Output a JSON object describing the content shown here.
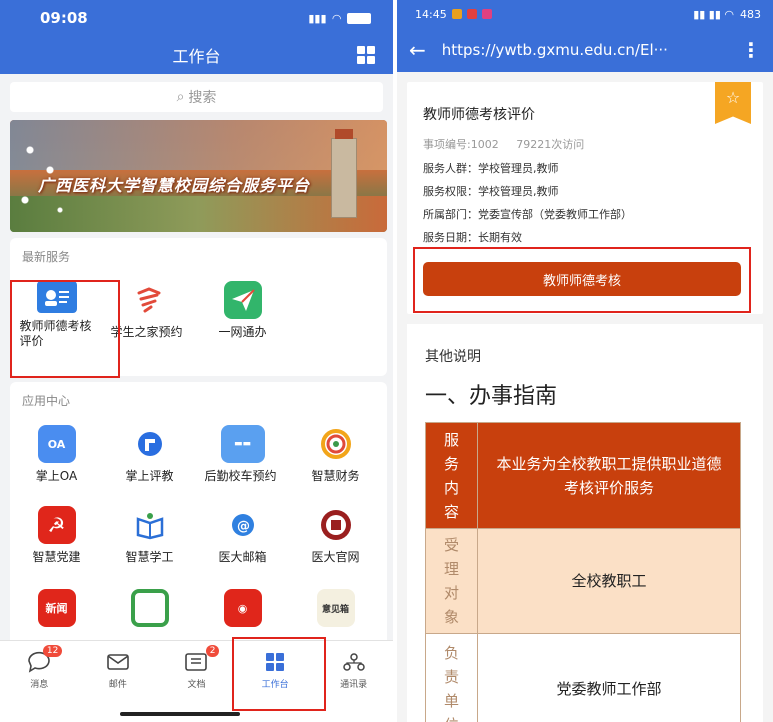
{
  "left": {
    "status_time": "09:08",
    "header_title": "工作台",
    "search_placeholder": "搜索",
    "banner_text": "广西医科大学智慧校园综合服务平台",
    "latest_section": {
      "title": "最新服务",
      "items": [
        {
          "label": "教师师德考核评价",
          "icon": "teacher-card-icon"
        },
        {
          "label": "学生之家预约",
          "icon": "student-home-icon"
        },
        {
          "label": "一网通办",
          "icon": "paper-plane-icon"
        }
      ]
    },
    "app_center": {
      "title": "应用中心",
      "items": [
        {
          "label": "掌上OA",
          "icon": "oa-icon"
        },
        {
          "label": "掌上评教",
          "icon": "teaching-eval-icon"
        },
        {
          "label": "后勤校车预约",
          "icon": "school-bus-icon"
        },
        {
          "label": "智慧财务",
          "icon": "finance-icon"
        },
        {
          "label": "智慧党建",
          "icon": "party-building-icon"
        },
        {
          "label": "智慧学工",
          "icon": "student-affairs-icon"
        },
        {
          "label": "医大邮箱",
          "icon": "mail-icon"
        },
        {
          "label": "医大官网",
          "icon": "official-site-icon"
        }
      ]
    },
    "bottom_icons_partial": {
      "news_label": "新闻",
      "opinion_label": "意见箱"
    },
    "tabs": [
      {
        "label": "消息",
        "icon": "message-icon",
        "badge": "12"
      },
      {
        "label": "邮件",
        "icon": "mail-icon",
        "badge": ""
      },
      {
        "label": "文档",
        "icon": "document-icon",
        "badge": "2"
      },
      {
        "label": "工作台",
        "icon": "workbench-icon",
        "badge": "",
        "active": true
      },
      {
        "label": "通讯录",
        "icon": "contacts-icon",
        "badge": ""
      }
    ],
    "colors": {
      "primary": "#3a6fd8",
      "highlight": "#e0241c"
    }
  },
  "right": {
    "status_time": "14:45",
    "status_right": "483",
    "url": "https://ywtb.gxmu.edu.cn/El···",
    "service_name": "教师师德考核评价",
    "meta_id": "事项编号:1002",
    "meta_visits": "79221次访问",
    "info": [
      "服务人群：学校管理员,教师",
      "服务权限：学校管理员,教师",
      "所属部门：党委宣传部（党委教师工作部）",
      "服务日期：长期有效"
    ],
    "action_button": "教师师德考核",
    "other_title": "其他说明",
    "guide_title": "一、办事指南",
    "table": [
      {
        "key": "服务内容",
        "value": "本业务为全校教职工提供职业道德考核评价服务"
      },
      {
        "key": "受理对象",
        "value": "全校教职工"
      },
      {
        "key": "负责单位",
        "value": "党委教师工作部"
      }
    ],
    "colors": {
      "accent": "#c8400d",
      "bookmark": "#f5a623"
    }
  }
}
